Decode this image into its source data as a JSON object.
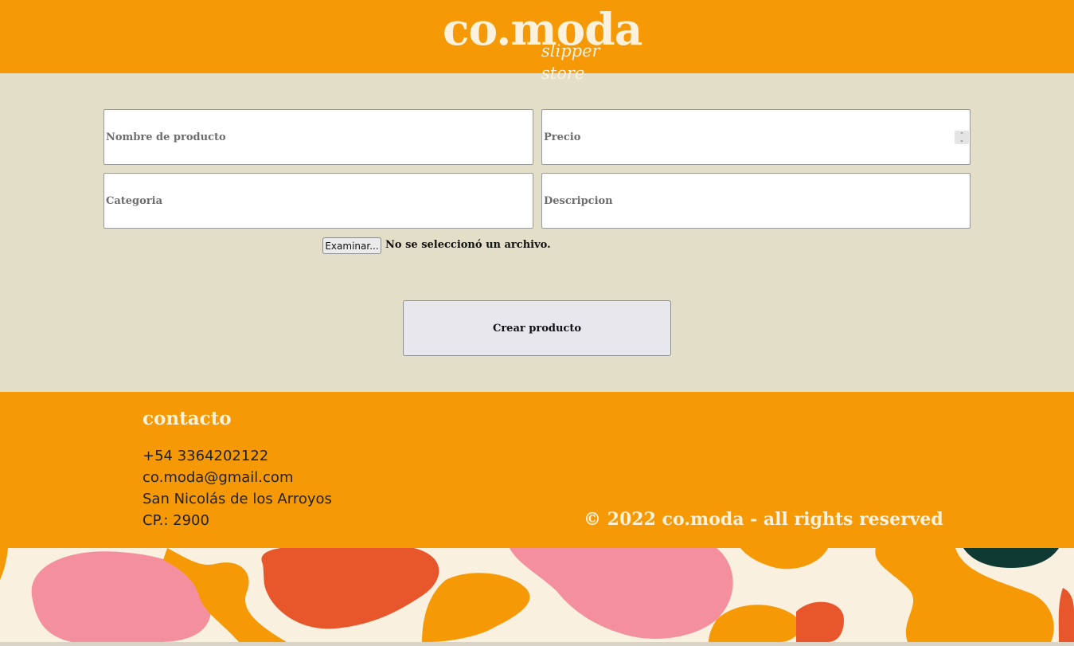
{
  "header": {
    "logo_main": "co.moda",
    "logo_sub": "slipper store"
  },
  "form": {
    "nombre_placeholder": "Nombre de producto",
    "precio_placeholder": "Precio",
    "categoria_placeholder": "Categoria",
    "descripcion_placeholder": "Descripcion",
    "file_button_label": "Examinar...",
    "file_status": "No se seleccionó un archivo.",
    "submit_label": "Crear producto"
  },
  "footer": {
    "title": "contacto",
    "phone": "+54 3364202122",
    "email": "co.moda@gmail.com",
    "city": "San Nicolás de los Arroyos",
    "postal_code": "CP.: 2900",
    "copyright": "© 2022 co.moda - all rights reserved"
  },
  "colors": {
    "brand_orange": "#f59a06",
    "cream": "#fbf1dc",
    "background": "#e3dec8",
    "pattern_pink": "#f48fa0",
    "pattern_red": "#e8572c",
    "pattern_orange": "#f59a06",
    "pattern_dark": "#0f3a33"
  }
}
